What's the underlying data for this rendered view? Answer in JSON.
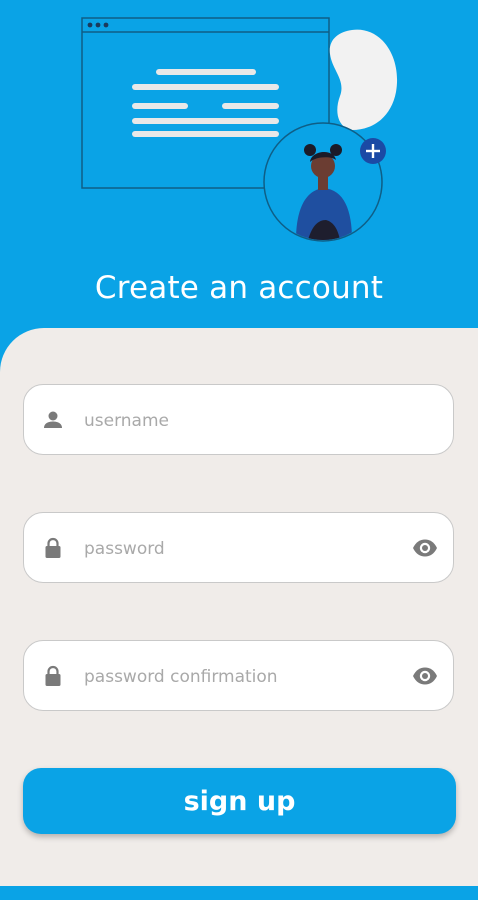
{
  "header": {
    "title": "Create an account"
  },
  "form": {
    "username_placeholder": "username",
    "password_placeholder": "password",
    "confirm_placeholder": "password confirmation",
    "submit_label": "sign up"
  },
  "icons": {
    "user": "person-icon",
    "lock": "lock-icon",
    "visibility": "eye-icon",
    "add": "plus-icon"
  },
  "colors": {
    "primary": "#0aa3e6",
    "panel": "#f0ece9",
    "field_bg": "#ffffff",
    "icon_gray": "#7a7a7a"
  }
}
